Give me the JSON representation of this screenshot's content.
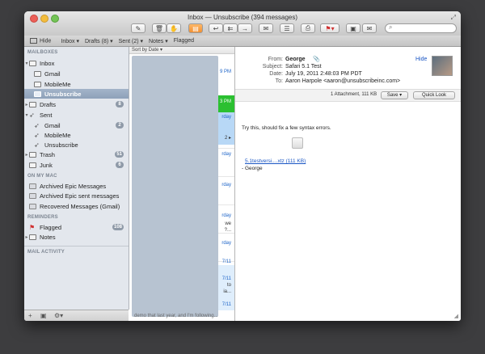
{
  "window": {
    "title": "Inbox — Unsubscribe (394 messages)"
  },
  "search": {
    "placeholder": ""
  },
  "favorites": {
    "hide": "Hide",
    "inbox": "Inbox ▾",
    "drafts": "Drafts (8) ▾",
    "sent": "Sent (2) ▾",
    "notes": "Notes ▾",
    "flagged": "Flagged"
  },
  "sidebar": {
    "mailboxes_header": "MAILBOXES",
    "inbox": "Inbox",
    "gmail": "Gmail",
    "mobileme": "MobileMe",
    "unsubscribe": "Unsubscribe",
    "drafts": "Drafts",
    "drafts_count": "8",
    "sent": "Sent",
    "sent_gmail": "Gmail",
    "sent_gmail_count": "2",
    "sent_mobileme": "MobileMe",
    "sent_unsubscribe": "Unsubscribe",
    "trash": "Trash",
    "trash_count": "51",
    "junk": "Junk",
    "junk_count": "6",
    "on_my_mac_header": "ON MY MAC",
    "archived_epic": "Archived Epic Messages",
    "archived_epic_sent": "Archived Epic sent messages",
    "recovered": "Recovered Messages (Gmail)",
    "reminders_header": "REMINDERS",
    "flagged": "Flagged",
    "flagged_count": "108",
    "notes": "Notes",
    "mail_activity_header": "MAIL ACTIVITY"
  },
  "list": {
    "sort_label": "Sort by Date ▾",
    "frag1": "9 PM",
    "frag2": "3 PM",
    "frag3": "rday",
    "frag4": "2 ▸",
    "frag5": "rday",
    "frag6": "rday",
    "frag7": "rday",
    "frag8": "we",
    "frag9": "?...",
    "frag10": "rday",
    "frag11": "7/11",
    "frag12": "7/11",
    "frag13": "to",
    "frag14": "ia...",
    "frag15": "7/11",
    "snippet": "demo that last year, and I'm following..."
  },
  "message": {
    "from_label": "From:",
    "from": "George",
    "subject_label": "Subject:",
    "subject": "Safari 5.1 Test",
    "date_label": "Date:",
    "date": "July 19, 2011 2:48:03 PM PDT",
    "to_label": "To:",
    "to": "Aaron Harpole <aaron@unsubscribeinc.com>",
    "hide": "Hide",
    "attachment_summary": "1 Attachment, 111 KB",
    "save": "Save ▾",
    "quick_look": "Quick Look",
    "body": "Try this, should fix a few syntax errors.",
    "attachment_name": "5.1testversi....xtz (111 KB)",
    "signature": "- George"
  }
}
